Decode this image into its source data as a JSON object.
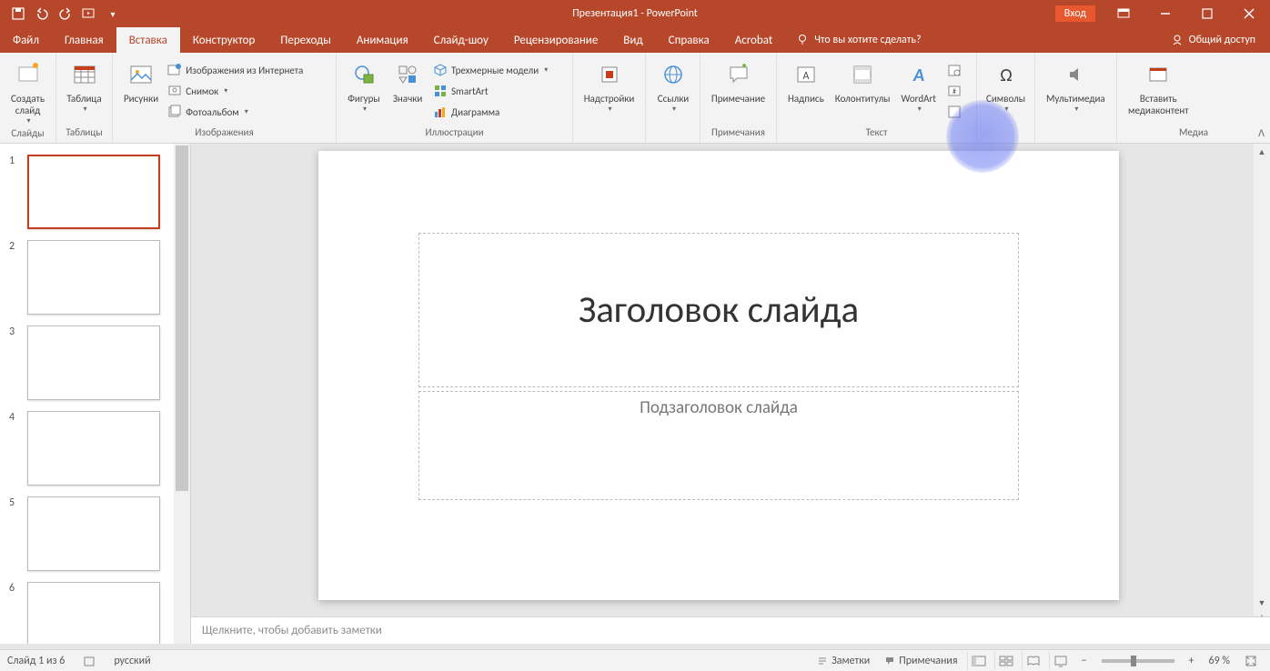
{
  "title": "Презентация1 - PowerPoint",
  "login": "Вход",
  "tabs": {
    "file": "Файл",
    "home": "Главная",
    "insert": "Вставка",
    "design": "Конструктор",
    "transitions": "Переходы",
    "animations": "Анимация",
    "slideshow": "Слайд-шоу",
    "review": "Рецензирование",
    "view": "Вид",
    "help": "Справка",
    "acrobat": "Acrobat",
    "tellme": "Что вы хотите сделать?",
    "share": "Общий доступ"
  },
  "ribbon": {
    "slides": {
      "new_slide": "Создать\nслайд",
      "group": "Слайды"
    },
    "tables": {
      "table": "Таблица",
      "group": "Таблицы"
    },
    "images": {
      "pictures": "Рисунки",
      "online": "Изображения из Интернета",
      "screenshot": "Снимок",
      "album": "Фотоальбом",
      "group": "Изображения"
    },
    "illustrations": {
      "shapes": "Фигуры",
      "icons": "Значки",
      "models3d": "Трехмерные модели",
      "smartart": "SmartArt",
      "chart": "Диаграмма",
      "group": "Иллюстрации"
    },
    "addins": {
      "addins": "Надстройки",
      "group": ""
    },
    "links": {
      "links": "Ссылки",
      "group": ""
    },
    "comments": {
      "comment": "Примечание",
      "group": "Примечания"
    },
    "text": {
      "textbox": "Надпись",
      "header": "Колонтитулы",
      "wordart": "WordArt",
      "group": "Текст"
    },
    "symbols": {
      "symbols": "Символы",
      "group": ""
    },
    "media": {
      "media": "Мультимедиа",
      "group": ""
    },
    "embed": {
      "embed": "Вставить\nмедиаконтент",
      "group": "Медиа"
    }
  },
  "slide": {
    "title_placeholder": "Заголовок слайда",
    "subtitle_placeholder": "Подзаголовок слайда"
  },
  "notes": {
    "placeholder": "Щелкните, чтобы добавить заметки"
  },
  "thumbnails": [
    "1",
    "2",
    "3",
    "4",
    "5",
    "6"
  ],
  "status": {
    "slide_info": "Слайд 1 из 6",
    "language": "русский",
    "notes": "Заметки",
    "comments": "Примечания",
    "zoom": "69 %"
  }
}
